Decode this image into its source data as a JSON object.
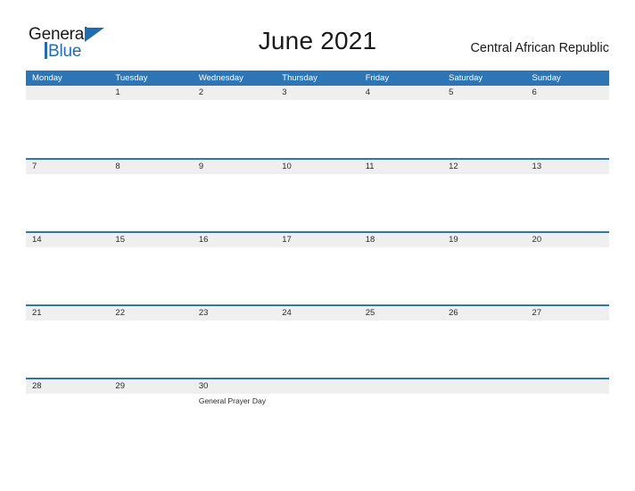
{
  "logo": {
    "word_top": "General",
    "word_bottom": "Blue",
    "triangle_color": "#1f6cb0"
  },
  "header": {
    "title": "June 2021",
    "country": "Central African Republic"
  },
  "colors": {
    "header_blue": "#2e75b6",
    "date_band_gray": "#efefef",
    "text": "#2b2b2b",
    "page_background": "#ffffff"
  },
  "calendar": {
    "month": "June",
    "year": "2021",
    "weekday_headers": [
      "Monday",
      "Tuesday",
      "Wednesday",
      "Thursday",
      "Friday",
      "Saturday",
      "Sunday"
    ],
    "weeks": [
      {
        "dates": [
          "",
          "1",
          "2",
          "3",
          "4",
          "5",
          "6"
        ],
        "events": [
          "",
          "",
          "",
          "",
          "",
          "",
          ""
        ]
      },
      {
        "dates": [
          "7",
          "8",
          "9",
          "10",
          "11",
          "12",
          "13"
        ],
        "events": [
          "",
          "",
          "",
          "",
          "",
          "",
          ""
        ]
      },
      {
        "dates": [
          "14",
          "15",
          "16",
          "17",
          "18",
          "19",
          "20"
        ],
        "events": [
          "",
          "",
          "",
          "",
          "",
          "",
          ""
        ]
      },
      {
        "dates": [
          "21",
          "22",
          "23",
          "24",
          "25",
          "26",
          "27"
        ],
        "events": [
          "",
          "",
          "",
          "",
          "",
          "",
          ""
        ]
      },
      {
        "dates": [
          "28",
          "29",
          "30",
          "",
          "",
          "",
          ""
        ],
        "events": [
          "",
          "",
          "General Prayer Day",
          "",
          "",
          "",
          ""
        ]
      }
    ]
  }
}
